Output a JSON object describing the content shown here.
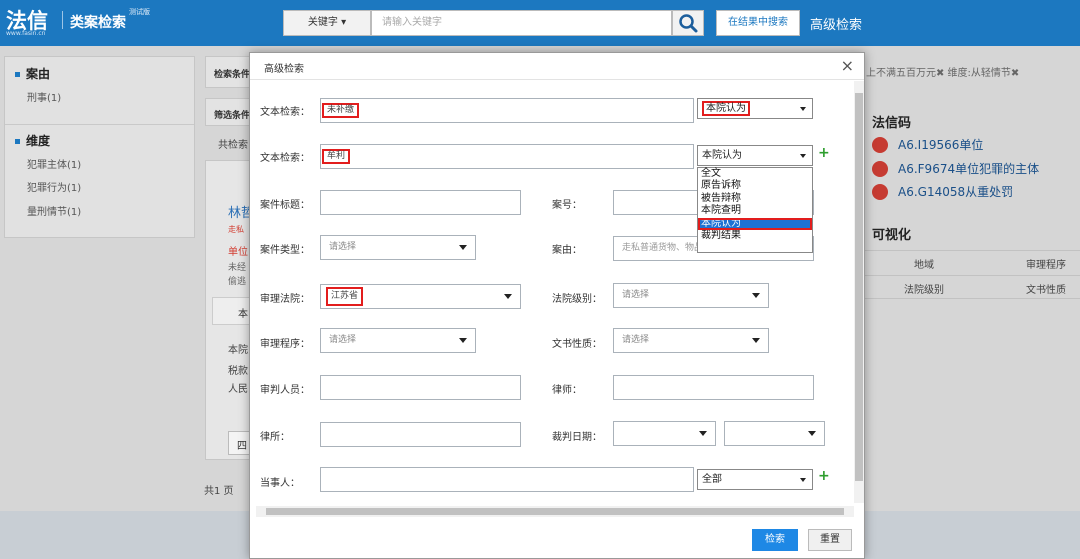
{
  "topbar": {
    "logo_main": "法信",
    "logo_sub": "www.fasin.cn",
    "logo_name": "类案检索",
    "logo_tag": "测试版",
    "keyword_button": "关键字 ▾",
    "search_placeholder": "请输入关键字",
    "search_in_results": "在结果中搜索",
    "advanced_search": "高级检索"
  },
  "sidebar": {
    "section1_title": "案由",
    "section1_items": [
      "刑事(1)"
    ],
    "section2_title": "维度",
    "section2_items": [
      "犯罪主体(1)",
      "犯罪行为(1)",
      "量刑情节(1)"
    ]
  },
  "middle": {
    "criteria_label": "检索条件",
    "filter_label": "筛选条件",
    "total_label": "共检索",
    "result_title": "林哲",
    "result_tag": "走私",
    "result_sub": "单位",
    "result_line1": "未经",
    "result_line2": "偷逃",
    "tab_label": "本",
    "body_line1": "本院",
    "body_line2": "税款",
    "body_line3": "人民",
    "page_button": "四",
    "pages_total": "共1 页"
  },
  "right_panel": {
    "tags_text": "上不满五百万元✖ 维度:从轻情节✖",
    "law_title": "法信码",
    "law_items": [
      "A6.I19566单位",
      "A6.F9674单位犯罪的主体",
      "A6.G14058从重处罚"
    ],
    "viz_title": "可视化",
    "viz_row1": [
      "地域",
      "审理程序"
    ],
    "viz_row2": [
      "法院级别",
      "文书性质"
    ]
  },
  "modal": {
    "title": "高级检索",
    "close": "×",
    "text_search_label": "文本检索：",
    "text_search_1_value": "未补缴",
    "text_search_1_scope": "本院认为",
    "text_search_2_value": "牟利",
    "text_search_2_scope": "本院认为",
    "scope_options": [
      "全文",
      "原告诉称",
      "被告辩称",
      "本院查明",
      "本院认为",
      "裁判结果"
    ],
    "scope_selected_index": 4,
    "case_title_label": "案件标题：",
    "case_no_label": "案号：",
    "case_type_label": "案件类型：",
    "case_type_value": "请选择",
    "cause_label": "案由：",
    "cause_value": "走私普通货物、物品罪",
    "court_label": "审理法院：",
    "court_value": "江苏省",
    "court_level_label": "法院级别：",
    "court_level_value": "请选择",
    "procedure_label": "审理程序：",
    "procedure_value": "请选择",
    "doc_nature_label": "文书性质：",
    "doc_nature_value": "请选择",
    "judge_label": "审判人员：",
    "lawyer_label": "律师：",
    "law_firm_label": "律所：",
    "date_label": "裁判日期：",
    "party_label": "当事人：",
    "party_scope": "全部",
    "plus": "+",
    "search_button": "检索",
    "reset_button": "重置"
  }
}
